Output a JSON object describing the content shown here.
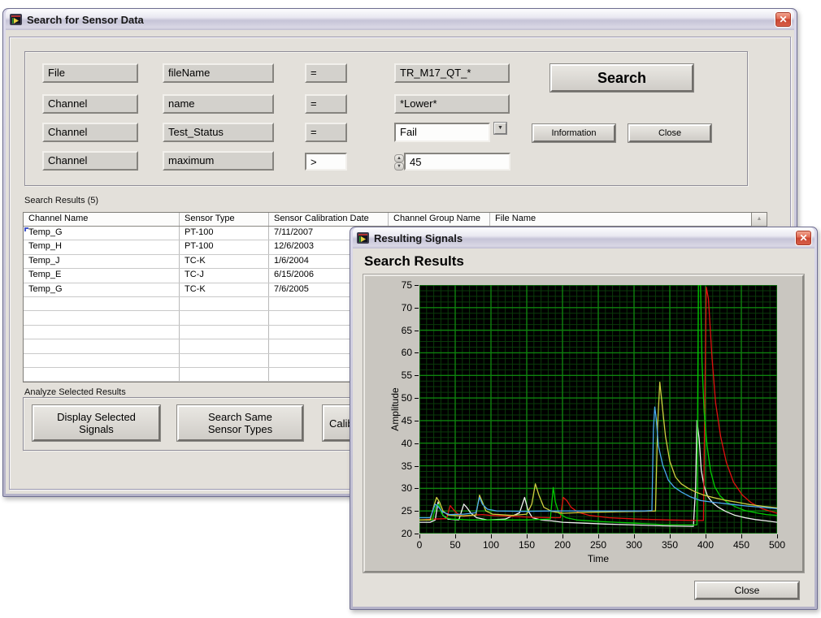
{
  "search_window": {
    "title": "Search for Sensor Data",
    "query": {
      "rows": [
        {
          "target": "File",
          "property": "fileName",
          "op": "=",
          "value": "TR_M17_QT_*"
        },
        {
          "target": "Channel",
          "property": "name",
          "op": "=",
          "value": "*Lower*"
        },
        {
          "target": "Channel",
          "property": "Test_Status",
          "op": "=",
          "value": "Fail"
        },
        {
          "target": "Channel",
          "property": "maximum",
          "op": ">",
          "value": "45"
        }
      ]
    },
    "buttons": {
      "search": "Search",
      "information": "Information",
      "close": "Close"
    },
    "results_label": "Search Results (5)",
    "table": {
      "columns": [
        "Channel Name",
        "Sensor Type",
        "Sensor Calibration Date",
        "Channel Group Name",
        "File Name"
      ],
      "rows": [
        [
          "Temp_G",
          "PT-100",
          "7/11/2007",
          "",
          ""
        ],
        [
          "Temp_H",
          "PT-100",
          "12/6/2003",
          "",
          ""
        ],
        [
          "Temp_J",
          "TC-K",
          "1/6/2004",
          "",
          ""
        ],
        [
          "Temp_E",
          "TC-J",
          "6/15/2006",
          "",
          ""
        ],
        [
          "Temp_G",
          "TC-K",
          "7/6/2005",
          "",
          ""
        ]
      ],
      "empty_rows": 6
    },
    "analyze_label": "Analyze Selected Results",
    "action_buttons": [
      {
        "label": "Display Selected\nSignals"
      },
      {
        "label": "Search Same\nSensor Types"
      },
      {
        "label": "Calib"
      }
    ]
  },
  "signals_window": {
    "title": "Resulting Signals",
    "heading": "Search Results",
    "close_label": "Close"
  },
  "icons": {
    "close": "✕",
    "dropdown": "▼",
    "spin_up": "▲",
    "spin_down": "▼",
    "scroll_up": "▲"
  },
  "chart_data": {
    "type": "line",
    "xlabel": "Time",
    "ylabel": "Amplitude",
    "xlim": [
      0,
      500
    ],
    "ylim": [
      20,
      75
    ],
    "x_ticks": [
      0,
      50,
      100,
      150,
      200,
      250,
      300,
      350,
      400,
      450,
      500
    ],
    "y_ticks": [
      20,
      25,
      30,
      35,
      40,
      45,
      50,
      55,
      60,
      65,
      70,
      75
    ],
    "grid": {
      "background": "#000000",
      "minor_color": "#0a3a0a",
      "major_color": "#0e820e",
      "minor_step_x": 10,
      "major_step_x": 50,
      "minor_step_y": 1.25,
      "major_step_y": 5
    },
    "legend_position": "none",
    "series": [
      {
        "name": "signal-white",
        "color": "#f0f0f0",
        "points": [
          [
            0,
            22.5
          ],
          [
            15,
            22.5
          ],
          [
            22,
            23
          ],
          [
            26,
            27
          ],
          [
            29,
            25.5
          ],
          [
            33,
            24
          ],
          [
            40,
            23.2
          ],
          [
            55,
            23
          ],
          [
            62,
            26.5
          ],
          [
            66,
            25.8
          ],
          [
            72,
            24.5
          ],
          [
            80,
            23.5
          ],
          [
            95,
            23
          ],
          [
            120,
            23.2
          ],
          [
            140,
            24.6
          ],
          [
            147,
            28
          ],
          [
            152,
            25
          ],
          [
            158,
            23.5
          ],
          [
            170,
            23
          ],
          [
            185,
            22.8
          ],
          [
            200,
            22.5
          ],
          [
            230,
            22.3
          ],
          [
            260,
            22.1
          ],
          [
            300,
            21.9
          ],
          [
            340,
            21.7
          ],
          [
            383,
            21.6
          ],
          [
            386,
            30
          ],
          [
            388,
            45
          ],
          [
            391,
            41
          ],
          [
            394,
            34
          ],
          [
            398,
            30.5
          ],
          [
            403,
            28.2
          ],
          [
            410,
            26.8
          ],
          [
            418,
            25.8
          ],
          [
            428,
            24.9
          ],
          [
            440,
            24.1
          ],
          [
            455,
            23.5
          ],
          [
            470,
            23.1
          ],
          [
            485,
            22.8
          ],
          [
            500,
            22.5
          ]
        ]
      },
      {
        "name": "signal-red",
        "color": "#e01010",
        "points": [
          [
            0,
            23
          ],
          [
            20,
            23.2
          ],
          [
            38,
            23.3
          ],
          [
            43,
            26.2
          ],
          [
            47,
            25.4
          ],
          [
            53,
            24.4
          ],
          [
            62,
            23.8
          ],
          [
            78,
            24.1
          ],
          [
            88,
            24.2
          ],
          [
            100,
            24
          ],
          [
            130,
            23.8
          ],
          [
            160,
            23.6
          ],
          [
            190,
            23.5
          ],
          [
            197,
            23.5
          ],
          [
            201,
            28
          ],
          [
            206,
            27.3
          ],
          [
            212,
            25.8
          ],
          [
            222,
            24.7
          ],
          [
            238,
            24
          ],
          [
            265,
            23.5
          ],
          [
            305,
            23.2
          ],
          [
            350,
            23
          ],
          [
            390,
            22.9
          ],
          [
            397,
            22.9
          ],
          [
            399,
            50
          ],
          [
            401,
            74.5
          ],
          [
            404,
            72
          ],
          [
            409,
            59
          ],
          [
            414,
            49
          ],
          [
            421,
            41.5
          ],
          [
            429,
            35.8
          ],
          [
            439,
            31.4
          ],
          [
            451,
            28.6
          ],
          [
            464,
            26.8
          ],
          [
            479,
            25.5
          ],
          [
            500,
            24.5
          ]
        ]
      },
      {
        "name": "signal-green",
        "color": "#00cc00",
        "points": [
          [
            0,
            23
          ],
          [
            18,
            23
          ],
          [
            23,
            26
          ],
          [
            27,
            26.5
          ],
          [
            31,
            24.5
          ],
          [
            36,
            23.5
          ],
          [
            45,
            23.2
          ],
          [
            70,
            23
          ],
          [
            110,
            23
          ],
          [
            150,
            23
          ],
          [
            183,
            23.2
          ],
          [
            187,
            30.2
          ],
          [
            190,
            27
          ],
          [
            195,
            24.5
          ],
          [
            205,
            23.5
          ],
          [
            220,
            23
          ],
          [
            260,
            22.6
          ],
          [
            300,
            22.3
          ],
          [
            340,
            22
          ],
          [
            383,
            21.9
          ],
          [
            388,
            21.9
          ],
          [
            390,
            75
          ],
          [
            393,
            75
          ],
          [
            395,
            58
          ],
          [
            398,
            47
          ],
          [
            402,
            39.5
          ],
          [
            407,
            33.8
          ],
          [
            413,
            30.3
          ],
          [
            420,
            28.4
          ],
          [
            430,
            26.9
          ],
          [
            442,
            25.9
          ],
          [
            455,
            25.1
          ],
          [
            470,
            24.6
          ],
          [
            485,
            24.2
          ],
          [
            500,
            24
          ]
        ]
      },
      {
        "name": "signal-yellow",
        "color": "#cfcf3f",
        "points": [
          [
            0,
            23
          ],
          [
            15,
            23
          ],
          [
            20,
            26
          ],
          [
            24,
            28
          ],
          [
            28,
            27
          ],
          [
            33,
            25
          ],
          [
            40,
            24.1
          ],
          [
            58,
            23.9
          ],
          [
            79,
            24.1
          ],
          [
            84,
            28.5
          ],
          [
            88,
            27
          ],
          [
            93,
            25
          ],
          [
            102,
            24.3
          ],
          [
            130,
            24
          ],
          [
            150,
            24.3
          ],
          [
            157,
            26.5
          ],
          [
            162,
            31
          ],
          [
            167,
            28.5
          ],
          [
            174,
            25.8
          ],
          [
            185,
            24.9
          ],
          [
            200,
            24.5
          ],
          [
            235,
            24.7
          ],
          [
            270,
            24.8
          ],
          [
            305,
            24.9
          ],
          [
            330,
            25
          ],
          [
            333,
            44
          ],
          [
            336,
            53.5
          ],
          [
            339,
            49
          ],
          [
            344,
            41.5
          ],
          [
            350,
            36
          ],
          [
            358,
            32.5
          ],
          [
            366,
            31
          ],
          [
            376,
            30
          ],
          [
            386,
            29.2
          ],
          [
            396,
            28.6
          ],
          [
            410,
            28
          ],
          [
            426,
            27.4
          ],
          [
            442,
            27
          ],
          [
            462,
            26.4
          ],
          [
            482,
            26
          ],
          [
            500,
            25.7
          ]
        ]
      },
      {
        "name": "signal-blue",
        "color": "#4aa8f0",
        "points": [
          [
            0,
            23.5
          ],
          [
            15,
            23.5
          ],
          [
            22,
            26.5
          ],
          [
            26,
            26
          ],
          [
            32,
            24.8
          ],
          [
            42,
            24.2
          ],
          [
            62,
            24.3
          ],
          [
            79,
            24.6
          ],
          [
            84,
            28
          ],
          [
            88,
            26.5
          ],
          [
            95,
            25.4
          ],
          [
            108,
            25
          ],
          [
            145,
            24.9
          ],
          [
            185,
            25
          ],
          [
            230,
            25
          ],
          [
            275,
            25
          ],
          [
            315,
            25
          ],
          [
            325,
            25.1
          ],
          [
            327,
            43
          ],
          [
            329,
            48
          ],
          [
            331,
            45.5
          ],
          [
            334,
            39.5
          ],
          [
            340,
            35.2
          ],
          [
            348,
            31.8
          ],
          [
            356,
            30.3
          ],
          [
            366,
            29.2
          ],
          [
            379,
            28.1
          ],
          [
            393,
            27.3
          ],
          [
            412,
            26.9
          ],
          [
            434,
            26.5
          ],
          [
            458,
            26.1
          ],
          [
            480,
            25.8
          ],
          [
            500,
            25.5
          ]
        ]
      }
    ]
  }
}
